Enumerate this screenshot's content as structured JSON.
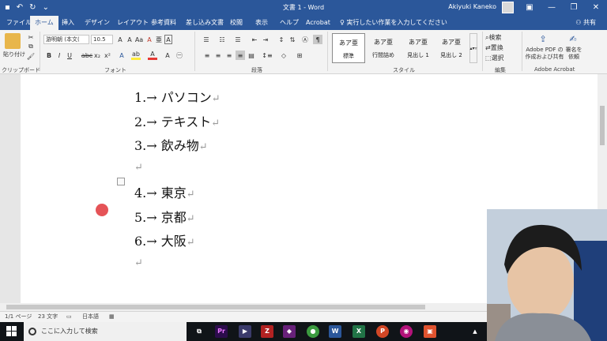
{
  "titlebar": {
    "title": "文書 1 - Word",
    "user": "Akiyuki Kaneko",
    "qat_icons": [
      "save-icon",
      "undo-icon",
      "redo-icon",
      "customize-icon"
    ]
  },
  "tabs": {
    "items": [
      "ファイル",
      "ホーム",
      "挿入",
      "デザイン",
      "レイアウト",
      "参考資料",
      "差し込み文書",
      "校閲",
      "表示",
      "ヘルプ",
      "Acrobat"
    ],
    "active": "ホーム",
    "tell_me": "実行したい作業を入力してください",
    "share": "共有"
  },
  "ribbon": {
    "clipboard": {
      "paste": "貼り付け",
      "label": "クリップボード"
    },
    "font": {
      "name": "游明朝 (本文(",
      "size": "10.5",
      "label": "フォント",
      "buttons": [
        "B",
        "I",
        "U",
        "abc",
        "x₂",
        "x²"
      ]
    },
    "paragraph": {
      "label": "段落"
    },
    "styles": {
      "label": "スタイル",
      "items": [
        {
          "sample": "あア亜",
          "name": "標準"
        },
        {
          "sample": "あア亜",
          "name": "行間詰め"
        },
        {
          "sample": "あア亜",
          "name": "見出し 1"
        },
        {
          "sample": "あア亜",
          "name": "見出し 2"
        }
      ]
    },
    "editing": {
      "label": "編集",
      "find": "検索",
      "replace": "置換",
      "select": "選択"
    },
    "acrobat": {
      "label": "Adobe Acrobat",
      "create_pdf": "Adobe PDF の作成および共有",
      "sign": "署名を依頼"
    }
  },
  "document": {
    "lines": [
      {
        "num": "1.",
        "text": "パソコン"
      },
      {
        "num": "2.",
        "text": "テキスト"
      },
      {
        "num": "3.",
        "text": "飲み物"
      },
      {
        "num": "",
        "text": ""
      },
      {
        "num": "4.",
        "text": "東京"
      },
      {
        "num": "5.",
        "text": "京都"
      },
      {
        "num": "6.",
        "text": "大阪"
      },
      {
        "num": "",
        "text": ""
      }
    ],
    "arrow": "→",
    "para_mark": "↵"
  },
  "status": {
    "page": "1/1 ページ",
    "words": "23 文字",
    "lang": "日本語"
  },
  "taskbar": {
    "search_placeholder": "ここに入力して検索"
  }
}
